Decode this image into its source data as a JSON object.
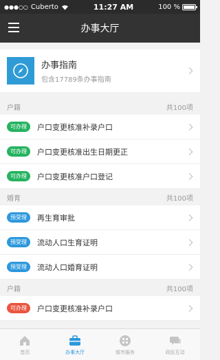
{
  "status_bar": {
    "carrier": "Cuberto",
    "time": "11:27 AM",
    "battery": "100 %",
    "battery_level": 1.0
  },
  "nav": {
    "title": "办事大厅",
    "menu_icon": "hamburger-icon"
  },
  "guide": {
    "title": "办事指南",
    "subtitle": "包含17789条办事指南",
    "icon": "compass-icon"
  },
  "sections": [
    {
      "title": "户籍",
      "count": "共100项",
      "items": [
        {
          "badge": "可办理",
          "color": "green",
          "label": "户口变更核准补录户口"
        },
        {
          "badge": "可办理",
          "color": "green",
          "label": "户口变更核准出生日期更正"
        },
        {
          "badge": "可办理",
          "color": "green",
          "label": "户口变更核准户口登记"
        }
      ]
    },
    {
      "title": "婚育",
      "count": "共100项",
      "items": [
        {
          "badge": "预受理",
          "color": "blue",
          "label": "再生育审批"
        },
        {
          "badge": "预受理",
          "color": "blue",
          "label": "流动人口生育证明"
        },
        {
          "badge": "预受理",
          "color": "blue",
          "label": "流动人口婚育证明"
        }
      ]
    },
    {
      "title": "户籍",
      "count": "共100项",
      "items": [
        {
          "badge": "可办理",
          "color": "red",
          "label": "户口变更核准补录户口"
        }
      ]
    }
  ],
  "tabs": [
    {
      "label": "首页",
      "icon": "home-icon",
      "active": false
    },
    {
      "label": "办事大厅",
      "icon": "briefcase-icon",
      "active": true
    },
    {
      "label": "城市服务",
      "icon": "grid-circle-icon",
      "active": false
    },
    {
      "label": "政民互动",
      "icon": "chat-icon",
      "active": false
    }
  ],
  "colors": {
    "accent": "#2c98dd",
    "green": "#25b35f",
    "red": "#e9553f",
    "nav": "#333333"
  }
}
